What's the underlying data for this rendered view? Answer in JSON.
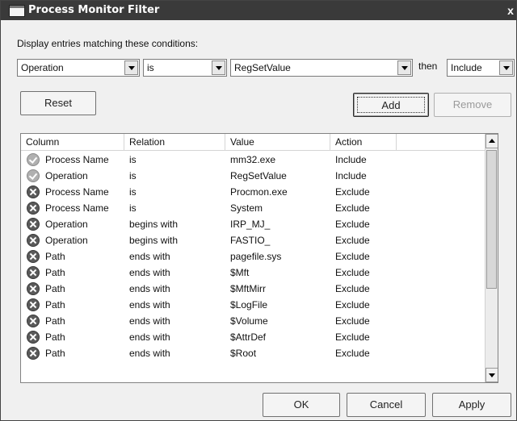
{
  "window": {
    "title": "Process Monitor Filter",
    "close_glyph": "x"
  },
  "conditions_label": "Display entries matching these conditions:",
  "filter": {
    "column_value": "Operation",
    "relation_value": "is",
    "value_value": "RegSetValue",
    "then_label": "then",
    "action_value": "Include"
  },
  "buttons": {
    "reset": "Reset",
    "add": "Add",
    "remove": "Remove",
    "ok": "OK",
    "cancel": "Cancel",
    "apply": "Apply"
  },
  "list": {
    "columns": [
      "Column",
      "Relation",
      "Value",
      "Action"
    ],
    "rows": [
      {
        "icon": "include-check-icon",
        "column": "Process Name",
        "relation": "is",
        "value": "mm32.exe",
        "action": "Include"
      },
      {
        "icon": "include-check-icon",
        "column": "Operation",
        "relation": "is",
        "value": "RegSetValue",
        "action": "Include"
      },
      {
        "icon": "exclude-x-icon",
        "column": "Process Name",
        "relation": "is",
        "value": "Procmon.exe",
        "action": "Exclude"
      },
      {
        "icon": "exclude-x-icon",
        "column": "Process Name",
        "relation": "is",
        "value": "System",
        "action": "Exclude"
      },
      {
        "icon": "exclude-x-icon",
        "column": "Operation",
        "relation": "begins with",
        "value": "IRP_MJ_",
        "action": "Exclude"
      },
      {
        "icon": "exclude-x-icon",
        "column": "Operation",
        "relation": "begins with",
        "value": "FASTIO_",
        "action": "Exclude"
      },
      {
        "icon": "exclude-x-icon",
        "column": "Path",
        "relation": "ends with",
        "value": "pagefile.sys",
        "action": "Exclude"
      },
      {
        "icon": "exclude-x-icon",
        "column": "Path",
        "relation": "ends with",
        "value": "$Mft",
        "action": "Exclude"
      },
      {
        "icon": "exclude-x-icon",
        "column": "Path",
        "relation": "ends with",
        "value": "$MftMirr",
        "action": "Exclude"
      },
      {
        "icon": "exclude-x-icon",
        "column": "Path",
        "relation": "ends with",
        "value": "$LogFile",
        "action": "Exclude"
      },
      {
        "icon": "exclude-x-icon",
        "column": "Path",
        "relation": "ends with",
        "value": "$Volume",
        "action": "Exclude"
      },
      {
        "icon": "exclude-x-icon",
        "column": "Path",
        "relation": "ends with",
        "value": "$AttrDef",
        "action": "Exclude"
      },
      {
        "icon": "exclude-x-icon",
        "column": "Path",
        "relation": "ends with",
        "value": "$Root",
        "action": "Exclude"
      }
    ]
  },
  "colors": {
    "titlebar": "#3a3a3a",
    "dialog": "#f0f0f0"
  }
}
